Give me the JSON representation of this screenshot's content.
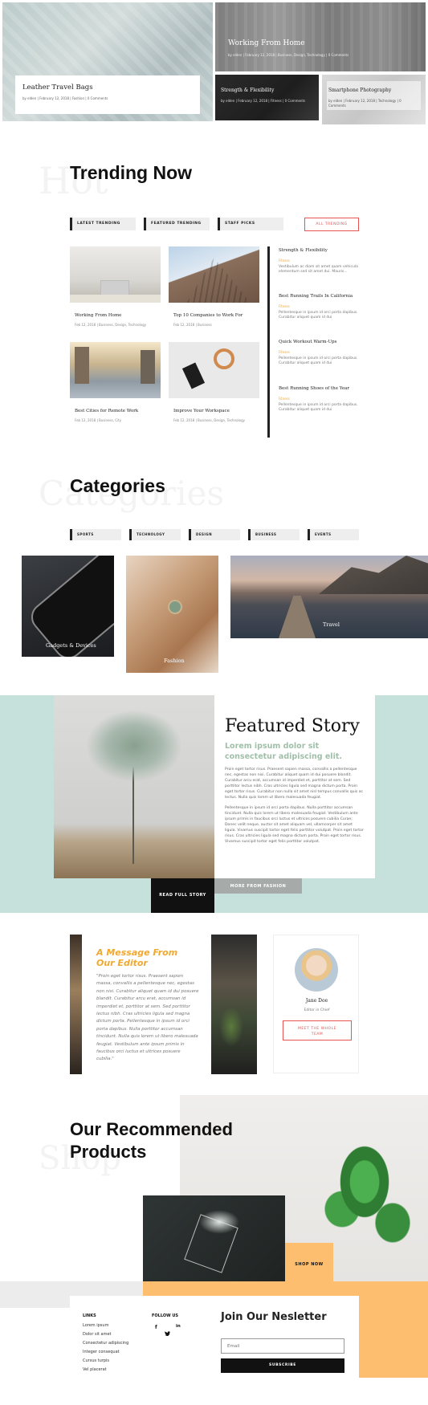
{
  "hero": {
    "main": {
      "title": "Leather Travel Bags",
      "meta": "by elden  |  February 12, 2018  |  Fashion  |  0 Comments"
    },
    "top_right": {
      "title": "Working From Home",
      "meta": "by elden  |  February 12, 2018  |  Business, Design, Technology  |  0 Comments"
    },
    "bottom_left": {
      "title": "Strength & Flexibility",
      "meta": "by elden  |  February 12, 2018  |  Fitness  |  0 Comments"
    },
    "bottom_right": {
      "title": "Smartphone Photography",
      "meta": "by elden  |  February 12, 2018  |  Technology  |  0 Comments"
    }
  },
  "trending": {
    "ghost": "Hot",
    "heading": "Trending Now",
    "tabs": [
      "LATEST TRENDING",
      "FEATURED TRENDING",
      "STAFF PICKS"
    ],
    "all_button": "ALL TRENDING",
    "cards": [
      {
        "title": "Working From Home",
        "meta": "Feb 12, 2018  |  Business, Design, Technology"
      },
      {
        "title": "Top 10 Companies to Work For",
        "meta": "Feb 12, 2018  |  Business"
      },
      {
        "title": "Best Cities for Remote Work",
        "meta": "Feb 12, 2018  |  Business, City"
      },
      {
        "title": "Improve Your Workspace",
        "meta": "Feb 12, 2018  |  Business, Design, Technology"
      }
    ],
    "side": [
      {
        "title": "Strength & Flexibility",
        "tag": "Fitness",
        "text": "Vestibulum ac diam sit amet quam vehicula elementum sed sit amet dui. Mauris..."
      },
      {
        "title": "Best Running Trails In California",
        "tag": "Fitness",
        "text": "Pellentesque in ipsum id orci porta dapibus. Curabitur aliquet quam id dui"
      },
      {
        "title": "Quick Workout Warm-Ups",
        "tag": "Fitness",
        "text": "Pellentesque in ipsum id orci porta dapibus. Curabitur aliquet quam id dui"
      },
      {
        "title": "Best Running Shoes of the Year",
        "tag": "Fitness",
        "text": "Pellentesque in ipsum id orci porta dapibus. Curabitur aliquet quam id dui"
      }
    ]
  },
  "categories": {
    "ghost": "Categories",
    "heading": "Categories",
    "tabs": [
      "SPORTS",
      "TECHNOLOGY",
      "DESIGN",
      "BUSINESS",
      "EVENTS"
    ],
    "tiles": [
      {
        "label": "Gadgets & Devices"
      },
      {
        "label": "Fashion"
      },
      {
        "label": "Travel"
      }
    ]
  },
  "featured": {
    "title": "Featured Story",
    "subtitle": "Lorem ipsum dolor sit consectetur adipiscing elit.",
    "para1": "Proin eget tortor risus. Praesent sapien massa, convallis a pellentesque nec, egestas non nisi. Curabitur aliquet quam id dui posuere blandit. Curabitur arcu erat, accumsan id imperdiet et, porttitor at sem. Sed porttitor lectus nibh. Cras ultricies ligula sed magna dictum porta. Proin eget tortor risus. Curabitur non nulla sit amet nisl tempus convallis quis ac lectus. Nulla quis lorem ut libero malesuada feugiat.",
    "para2": "Pellentesque in ipsum id orci porta dapibus. Nulla porttitor accumsan tincidunt. Nulla quis lorem ut libero malesuada feugiat. Vestibulum ante ipsum primis in faucibus orci luctus et ultrices posuere cubilia Curae; Donec velit neque, auctor sit amet aliquam vel, ullamcorper sit amet ligula. Vivamus suscipit tortor eget felis porttitor volutpat. Proin eget tortor risus. Cras ultricies ligula sed magna dictum porta. Proin eget tortor risus. Vivamus suscipit tortor eget felis porttitor volutpat.",
    "read_button": "READ FULL STORY",
    "more_button": "MORE FROM FASHION"
  },
  "editor": {
    "heading": "A Message From Our Editor",
    "quote": "\"Proin eget tortor risus. Praesent sapien massa, convallis a pellentesque nec, egestas non nisi. Curabitur aliquet quam id dui posuere blandit. Curabitur arcu erat, accumsan id imperdiet et, porttitor at sem. Sed porttitor lectus nibh. Cras ultricies ligula sed magna dictum porta. Pellentesque in ipsum id orci porta dapibus. Nulla porttitor accumsan tincidunt. Nulla quis lorem ut libero malesuada feugiat. Vestibulum ante ipsum primis in faucibus orci luctus et ultrices posuere cubilia.\"",
    "name": "Jane Doe",
    "role": "Editor in Chief",
    "team_button": "MEET THE WHOLE TEAM"
  },
  "shop": {
    "ghost": "Shop",
    "heading": "Our Recommended Products",
    "shop_button": "SHOP NOW"
  },
  "footer": {
    "links_heading": "LINKS",
    "links": [
      "Lorem ipsum",
      "Dolor sit amet",
      "Consectetur adipiscing",
      "Integer consequat",
      "Cursus turpis",
      "Vel placerat"
    ],
    "follow_heading": "FOLLOW US",
    "newsletter_heading": "Join Our Nesletter",
    "email_placeholder": "Email",
    "subscribe": "SUBSCRIBE"
  },
  "colors": {
    "accent": "#f0a830",
    "teal": "#c6e0dc",
    "orange": "#fdbe6f",
    "red": "#e55353",
    "sage": "#9fbfa8"
  }
}
